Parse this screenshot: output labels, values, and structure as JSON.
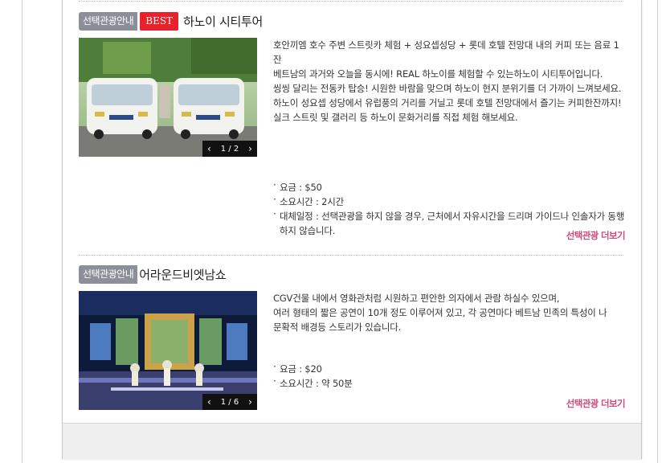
{
  "tours": [
    {
      "tag": "선택관광안내",
      "badge": "BEST",
      "title": "하노이 시티투어",
      "pager": "1 / 2",
      "description": [
        "호안끼엠 호수 주변 스트릿카 체험 + 성요셉성당 + 롯데 호텔 전망대 내의 커피 또는 음료 1잔",
        "베트남의 과거와 오늘을 동시에! REAL 하노이를 체험할 수 있는하노이 시티투어입니다.",
        "씽씽 달리는 전동카 탑승! 시원한 바람을 맞으며 하노이 현지 분위기를 더 가까이 느껴보세요.",
        "하노이 성요셉 성당에서 유럽풍의 거리를 거닐고 롯데 호텔 전망대에서 즐기는 커피한잔까지!",
        "실크 스트릿 및 갤러리 등 하노이 문화거리를 직접 체험 해보세요."
      ],
      "info": [
        "요금 : $50",
        "소요시간 : 2시간",
        "대체일정 : 선택관광을 하지 않을 경우, 근처에서 자유시간을 드리며 가이드나 인솔자가 동행하지 않습니다."
      ],
      "more": "선택관광 더보기"
    },
    {
      "tag": "선택관광안내",
      "title": "어라운드비엣남쇼",
      "pager": "1 / 6",
      "description": [
        "CGV건물 내에서 영화관처럼 시원하고 편안한 의자에서 관람 하실수 있으며,",
        "여러 형태의 짧은 공연이 10개 정도 이루어져 있고, 각 공연마다 베트남 민족의 특성이 나",
        "문확적 배경등 스토리가 있습니다."
      ],
      "info": [
        "요금 : $20",
        "소요시간 : 약 50분"
      ],
      "more": "선택관광 더보기"
    }
  ],
  "icons": {
    "prev": "chevron-left-icon",
    "next": "chevron-right-icon"
  }
}
